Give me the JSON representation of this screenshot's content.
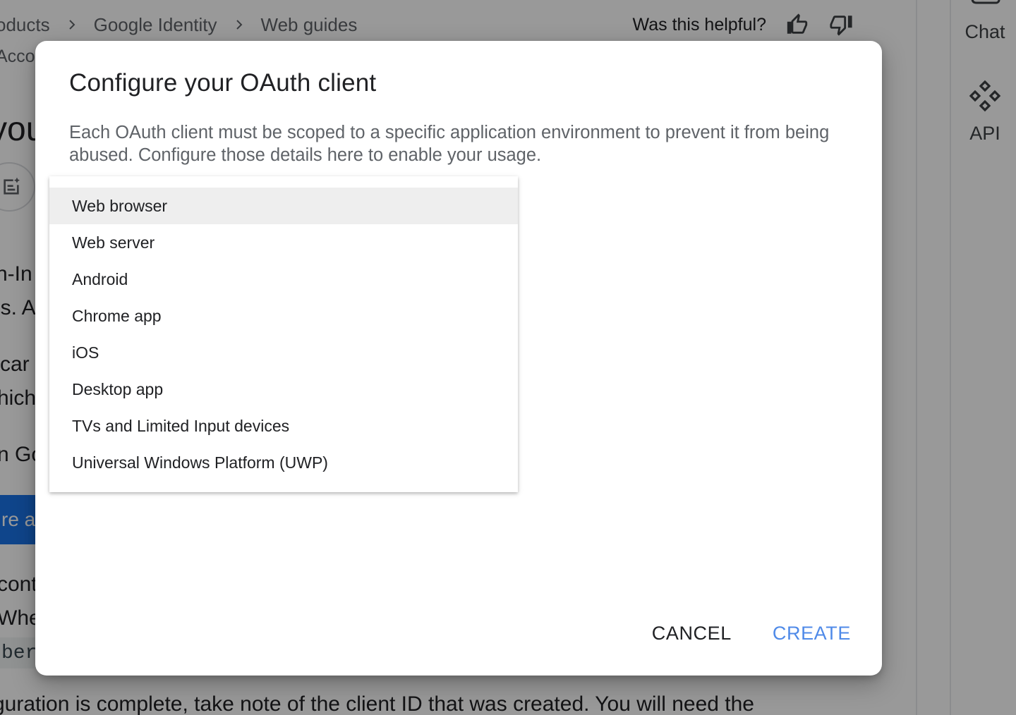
{
  "background": {
    "breadcrumb": [
      "oducts",
      "Google Identity",
      "Web guides"
    ],
    "helpful_label": "Was this helpful?",
    "account_fragment": "Accou",
    "title_fragment": "you",
    "text_fragments": [
      "n-In",
      "ls. A",
      "car",
      "hich",
      "n Go",
      "cont",
      "Whe"
    ],
    "cta_fragment": "re a",
    "code_fragment": "ber",
    "bottom_line": "guration is complete, take note of the client ID that was created. You will need the",
    "side_rail": {
      "chat_label": "Chat",
      "api_label": "API"
    }
  },
  "dialog": {
    "title": "Configure your OAuth client",
    "description": "Each OAuth client must be scoped to a specific application environment to prevent it from being abused. Configure those details here to enable your usage.",
    "options": [
      "Web browser",
      "Web server",
      "Android",
      "Chrome app",
      "iOS",
      "Desktop app",
      "TVs and Limited Input devices",
      "Universal Windows Platform (UWP)"
    ],
    "highlighted_option": "Web browser",
    "cancel_label": "CANCEL",
    "create_label": "CREATE"
  },
  "colors": {
    "accent": "#4f8ae8",
    "scrim": "rgba(0,0,0,0.40)",
    "cta_blue": "#1a73e8"
  }
}
